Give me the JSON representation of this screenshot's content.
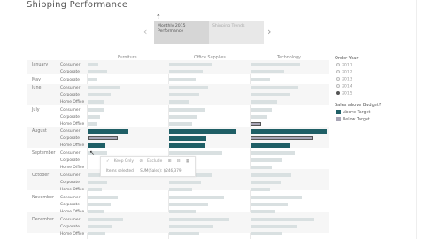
{
  "header": {
    "title": "Shipping Performance"
  },
  "story": {
    "active_point": "Monthly 2015 Performance",
    "inactive_point": "Shipping Trends",
    "prev_icon": "chevron-left-icon",
    "next_icon": "chevron-right-icon"
  },
  "columns": [
    "Furniture",
    "Office Supplies",
    "Technology"
  ],
  "rows": [
    {
      "month": "January",
      "segments": [
        "Consumer",
        "Corporate"
      ]
    },
    {
      "month": "May",
      "segments": [
        "Corporate"
      ]
    },
    {
      "month": "June",
      "segments": [
        "Consumer",
        "Corporate",
        "Home Office"
      ]
    },
    {
      "month": "July",
      "segments": [
        "Consumer",
        "Corporate",
        "Home Office"
      ]
    },
    {
      "month": "August",
      "segments": [
        "Consumer",
        "Corporate",
        "Home Office"
      ]
    },
    {
      "month": "September",
      "segments": [
        "Consumer",
        "Corporate",
        "Home Office"
      ]
    },
    {
      "month": "October",
      "segments": [
        "Consumer",
        "Corporate",
        "Home Office"
      ]
    },
    {
      "month": "November",
      "segments": [
        "Consumer",
        "Corporate",
        "Home Office"
      ]
    },
    {
      "month": "December",
      "segments": [
        "Consumer",
        "Corporate",
        "Home Office"
      ]
    }
  ],
  "tooltip": {
    "keep_only": "Keep Only",
    "exclude": "Exclude",
    "summary_items": "Items selected",
    "summary_sum": "SUM(Sales): $246,379"
  },
  "filter": {
    "title": "Order Year",
    "options": [
      "2011",
      "2012",
      "2013",
      "2014",
      "2015"
    ],
    "selected": "2015"
  },
  "legend": {
    "title": "Sales above Budget?",
    "items": [
      {
        "label": "Above Target",
        "color": "#1f5f66"
      },
      {
        "label": "Below Target",
        "color": "#a7a5b5"
      }
    ]
  },
  "colors": {
    "faint_bar": "#d9e0e1",
    "above": "#1f5f66",
    "below": "#a7a5b5"
  }
}
